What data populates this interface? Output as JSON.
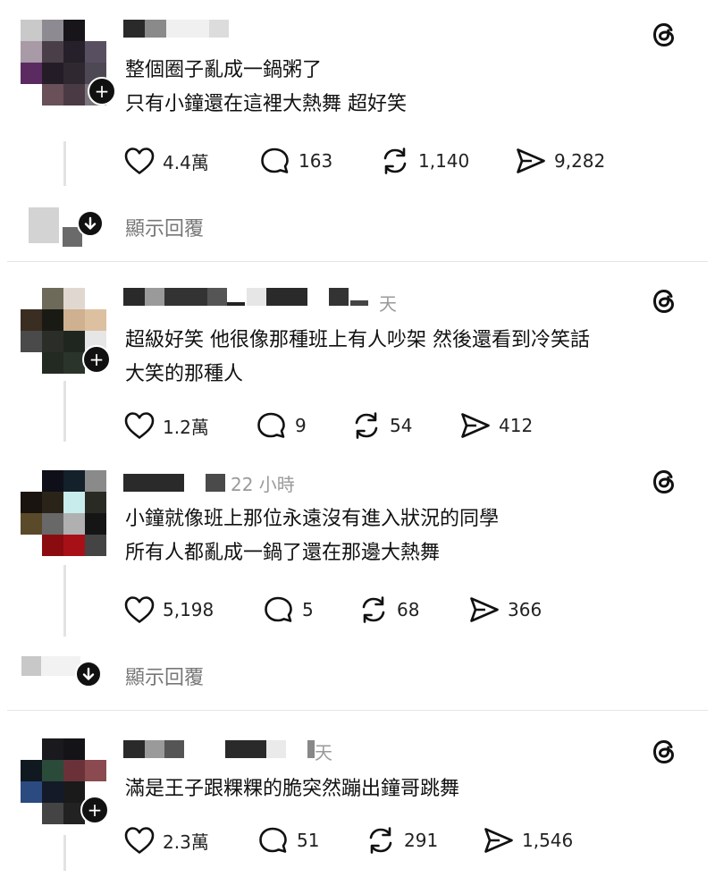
{
  "posts": [
    {
      "time": "",
      "lines": [
        "整個圈子亂成一鍋粥了",
        "只有小鐘還在這裡大熱舞 超好笑"
      ],
      "likes": "4.4萬",
      "comments": "163",
      "reposts": "1,140",
      "shares": "9,282",
      "show_replies": "顯示回覆"
    },
    {
      "time": "天",
      "lines": [
        "超級好笑 他很像那種班上有人吵架 然後還看到冷笑話",
        "大笑的那種人"
      ],
      "likes": "1.2萬",
      "comments": "9",
      "reposts": "54",
      "shares": "412"
    },
    {
      "time": "22 小時",
      "lines": [
        "小鐘就像班上那位永遠沒有進入狀況的同學",
        "所有人都亂成一鍋了還在那邊大熱舞"
      ],
      "likes": "5,198",
      "comments": "5",
      "reposts": "68",
      "shares": "366",
      "show_replies": "顯示回覆"
    },
    {
      "time": "天",
      "lines": [
        "滿是王子跟粿粿的脆突然蹦出鐘哥跳舞"
      ],
      "likes": "2.3萬",
      "comments": "51",
      "reposts": "291",
      "shares": "1,546"
    }
  ],
  "icons": {
    "like": "heart-icon",
    "comment": "comment-icon",
    "repost": "repost-icon",
    "share": "share-icon",
    "threads": "threads-logo-icon",
    "expand": "arrow-down-icon",
    "follow": "plus-icon"
  }
}
